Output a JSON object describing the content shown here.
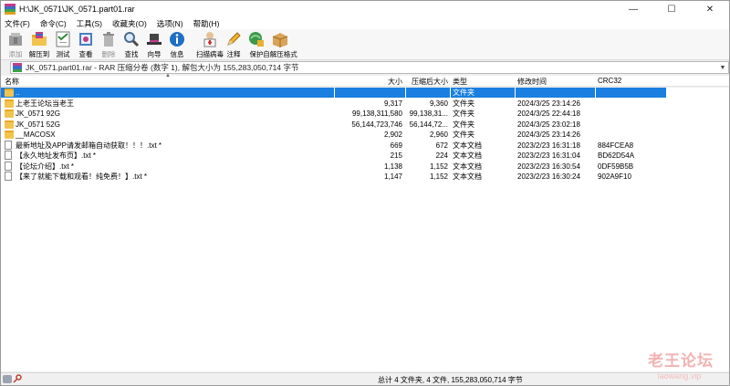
{
  "window": {
    "title": "H:\\JK_0571\\JK_0571.part01.rar",
    "minimize": "—",
    "maximize": "☐",
    "close": "✕"
  },
  "menu": [
    "文件(F)",
    "命令(C)",
    "工具(S)",
    "收藏夹(O)",
    "选项(N)",
    "帮助(H)"
  ],
  "toolbar": {
    "add": "添加",
    "extract": "解压到",
    "test": "测试",
    "view": "查看",
    "delete": "删除",
    "find": "查找",
    "wizard": "向导",
    "info": "信息",
    "virusscan": "扫描病毒",
    "comment": "注释",
    "protect": "保护",
    "sfx": "自解压格式"
  },
  "pathbar": {
    "text": "JK_0571.part01.rar - RAR 压缩分卷 (数字 1), 解包大小为 155,283,050,714 字节"
  },
  "columns": {
    "name": "名称",
    "size": "大小",
    "packed": "压缩后大小",
    "type": "类型",
    "modified": "修改时间",
    "crc": "CRC32"
  },
  "files": [
    {
      "name": "..",
      "size": "",
      "packed": "",
      "type": "文件夹",
      "modified": "",
      "crc": "",
      "kind": "folder-up",
      "selected": true
    },
    {
      "name": "上老王论坛当老王",
      "size": "9,317",
      "packed": "9,360",
      "type": "文件夹",
      "modified": "2024/3/25 23:14:26",
      "crc": "",
      "kind": "folder"
    },
    {
      "name": "JK_0571 92G",
      "size": "99,138,311,580",
      "packed": "99,138,31...",
      "type": "文件夹",
      "modified": "2024/3/25 22:44:18",
      "crc": "",
      "kind": "folder"
    },
    {
      "name": "JK_0571 52G",
      "size": "56,144,723,746",
      "packed": "56,144,72...",
      "type": "文件夹",
      "modified": "2024/3/25 23:02:18",
      "crc": "",
      "kind": "folder"
    },
    {
      "name": "__MACOSX",
      "size": "2,902",
      "packed": "2,960",
      "type": "文件夹",
      "modified": "2024/3/25 23:14:26",
      "crc": "",
      "kind": "folder"
    },
    {
      "name": "最新地址及APP请发邮箱自动获取！！！.txt *",
      "size": "669",
      "packed": "672",
      "type": "文本文档",
      "modified": "2023/2/23 16:31:18",
      "crc": "884FCEA8",
      "kind": "txt"
    },
    {
      "name": "【永久地址发布页】.txt *",
      "size": "215",
      "packed": "224",
      "type": "文本文档",
      "modified": "2023/2/23 16:31:04",
      "crc": "BD62D54A",
      "kind": "txt"
    },
    {
      "name": "【论坛介绍】.txt *",
      "size": "1,138",
      "packed": "1,152",
      "type": "文本文档",
      "modified": "2023/2/23 16:30:54",
      "crc": "0DF59B5B",
      "kind": "txt"
    },
    {
      "name": "【来了就能下载和观看！纯免费！】.txt *",
      "size": "1,147",
      "packed": "1,152",
      "type": "文本文档",
      "modified": "2023/2/23 16:30:24",
      "crc": "902A9F10",
      "kind": "txt"
    }
  ],
  "status": {
    "text": "总计 4 文件夹, 4 文件, 155,283,050,714 字节"
  },
  "watermark": {
    "line1": "老王论坛",
    "line2": "laowang.vip"
  },
  "colors": {
    "selection": "#1a7fe0",
    "folder": "#f2c44f",
    "watermark": "#f0b2b2"
  }
}
